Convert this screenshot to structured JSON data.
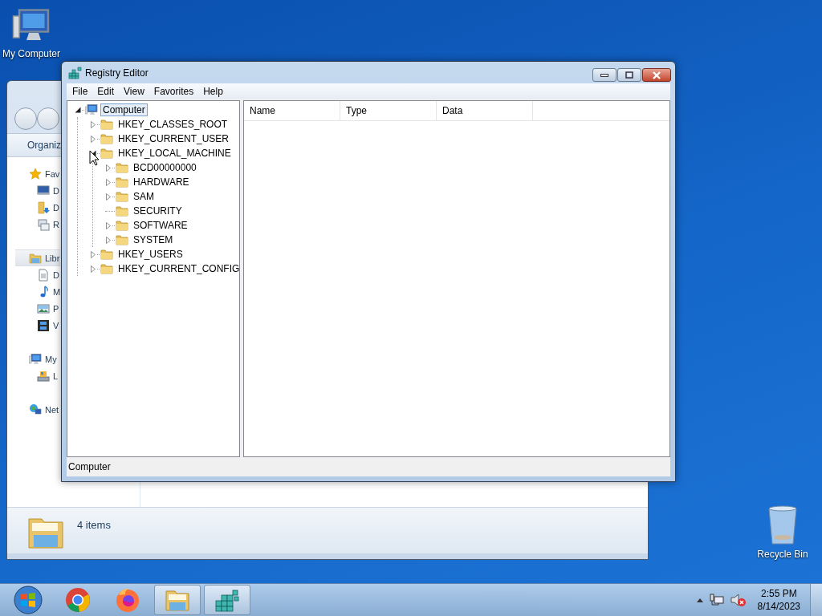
{
  "desktop_icons": [
    {
      "label": "My Computer",
      "kind": "computer"
    },
    {
      "label": "Recycle Bin",
      "kind": "recycle"
    }
  ],
  "explorer": {
    "toolbar": "Organiz",
    "sidebar": [
      {
        "label": "Fav",
        "kind": "star",
        "selected": false,
        "children": [
          {
            "label": "D",
            "kind": "desktop",
            "selected": false
          },
          {
            "label": "D",
            "kind": "downloads",
            "selected": false
          },
          {
            "label": "R",
            "kind": "recent",
            "selected": false
          }
        ]
      },
      {
        "label": "Libr",
        "kind": "library",
        "selected": true,
        "children": [
          {
            "label": "D",
            "kind": "document",
            "selected": false
          },
          {
            "label": "M",
            "kind": "music",
            "selected": false
          },
          {
            "label": "P",
            "kind": "pictures",
            "selected": false
          },
          {
            "label": "V",
            "kind": "video",
            "selected": false
          }
        ]
      },
      {
        "label": "My",
        "kind": "computer",
        "selected": false,
        "children": [
          {
            "label": "L",
            "kind": "disk",
            "selected": false
          }
        ]
      },
      {
        "label": "Net",
        "kind": "network",
        "selected": false
      }
    ],
    "status": "4 items"
  },
  "registry": {
    "title": "Registry Editor",
    "menu": [
      "File",
      "Edit",
      "View",
      "Favorites",
      "Help"
    ],
    "tree": [
      {
        "label": "Computer",
        "kind": "computer",
        "expandable": true,
        "expanded": true,
        "selected": true,
        "children": [
          {
            "label": "HKEY_CLASSES_ROOT",
            "kind": "folder",
            "expandable": true,
            "expanded": false,
            "selected": false
          },
          {
            "label": "HKEY_CURRENT_USER",
            "kind": "folder",
            "expandable": true,
            "expanded": false,
            "selected": false
          },
          {
            "label": "HKEY_LOCAL_MACHINE",
            "kind": "folder",
            "expandable": true,
            "expanded": true,
            "selected": false,
            "children": [
              {
                "label": "BCD00000000",
                "kind": "folder",
                "expandable": true,
                "expanded": false,
                "selected": false
              },
              {
                "label": "HARDWARE",
                "kind": "folder",
                "expandable": true,
                "expanded": false,
                "selected": false
              },
              {
                "label": "SAM",
                "kind": "folder",
                "expandable": true,
                "expanded": false,
                "selected": false
              },
              {
                "label": "SECURITY",
                "kind": "folder",
                "expandable": false,
                "selected": false
              },
              {
                "label": "SOFTWARE",
                "kind": "folder",
                "expandable": true,
                "expanded": false,
                "selected": false
              },
              {
                "label": "SYSTEM",
                "kind": "folder",
                "expandable": true,
                "expanded": false,
                "selected": false
              }
            ]
          },
          {
            "label": "HKEY_USERS",
            "kind": "folder",
            "expandable": true,
            "expanded": false,
            "selected": false
          },
          {
            "label": "HKEY_CURRENT_CONFIG",
            "kind": "folder",
            "expandable": true,
            "expanded": false,
            "selected": false
          }
        ]
      }
    ],
    "columns": [
      "Name",
      "Type",
      "Data"
    ],
    "status": "Computer"
  },
  "taskbar": {
    "items": [
      {
        "kind": "start",
        "running": false
      },
      {
        "kind": "browser-round",
        "running": false
      },
      {
        "kind": "browser-fox",
        "running": false
      },
      {
        "kind": "explorer",
        "running": true
      },
      {
        "kind": "registry",
        "running": true
      }
    ],
    "clock": {
      "time": "2:55 PM",
      "date": "8/14/2023"
    }
  }
}
